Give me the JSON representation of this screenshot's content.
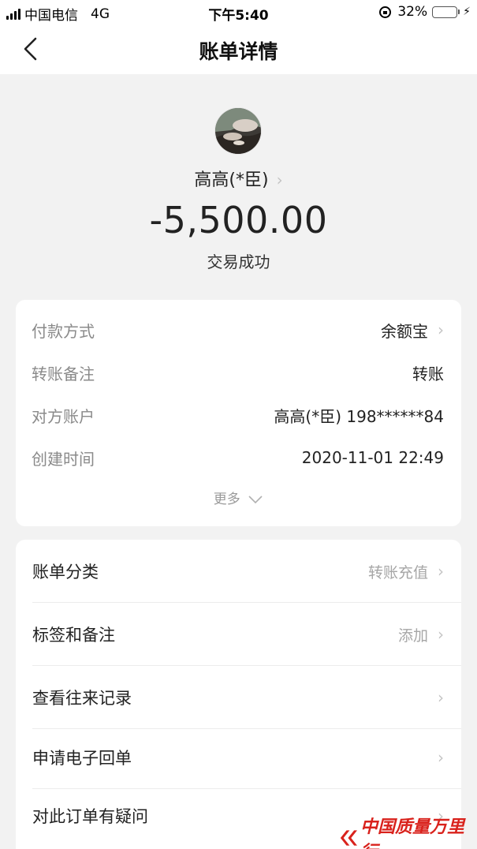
{
  "status_bar": {
    "carrier": "中国电信",
    "network": "4G",
    "time": "下午5:40",
    "battery_percent": "32%",
    "battery_level": 0.32,
    "battery_color": "#4cd964"
  },
  "nav": {
    "back_icon": "chevron-left-icon",
    "title": "账单详情"
  },
  "header": {
    "payee": "高高(*臣)",
    "amount": "-5,500.00",
    "status": "交易成功"
  },
  "details": {
    "rows": [
      {
        "label": "付款方式",
        "value": "余额宝",
        "has_arrow": true
      },
      {
        "label": "转账备注",
        "value": "转账",
        "has_arrow": false
      },
      {
        "label": "对方账户",
        "value": "高高(*臣) 198******84",
        "has_arrow": false
      },
      {
        "label": "创建时间",
        "value": "2020-11-01 22:49",
        "has_arrow": false
      }
    ],
    "more": "更多"
  },
  "actions": {
    "rows": [
      {
        "label": "账单分类",
        "value": "转账充值"
      },
      {
        "label": "标签和备注",
        "value": "添加"
      },
      {
        "label": "查看往来记录",
        "value": ""
      },
      {
        "label": "申请电子回单",
        "value": ""
      },
      {
        "label": "对此订单有疑问",
        "value": ""
      }
    ]
  },
  "watermark": {
    "text": "中国质量万里行",
    "color": "#d9221c"
  }
}
